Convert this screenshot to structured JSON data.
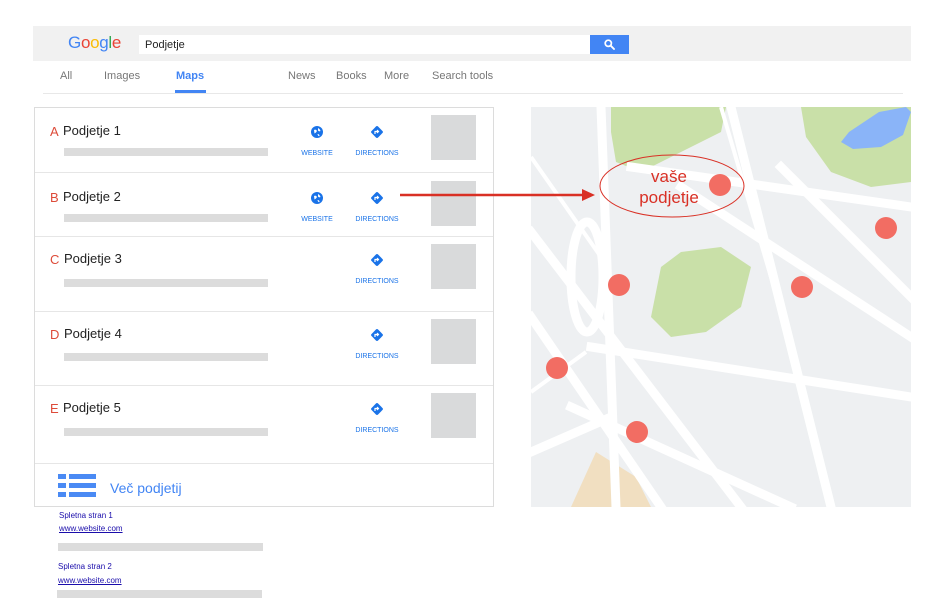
{
  "logo": {
    "letters": [
      "G",
      "o",
      "o",
      "g",
      "l",
      "e"
    ],
    "colors": [
      "#4285f4",
      "#ea4335",
      "#fbbc05",
      "#4285f4",
      "#34a853",
      "#ea4335"
    ]
  },
  "search": {
    "value": "Podjetje"
  },
  "tabs": [
    {
      "label": "All"
    },
    {
      "label": "Images"
    },
    {
      "label": "Maps"
    },
    {
      "label": "News"
    },
    {
      "label": "Books"
    },
    {
      "label": "More"
    },
    {
      "label": "Search tools"
    }
  ],
  "listings": [
    {
      "letter": "A",
      "name": "Podjetje  1",
      "website_label": "WEBSITE",
      "directions_label": "DIRECTIONS"
    },
    {
      "letter": "B",
      "name": "Podjetje  2",
      "website_label": "WEBSITE",
      "directions_label": "DIRECTIONS"
    },
    {
      "letter": "C",
      "name": "Podjetje  3",
      "directions_label": "DIRECTIONS"
    },
    {
      "letter": "D",
      "name": "Podjetje  4",
      "directions_label": "DIRECTIONS"
    },
    {
      "letter": "E",
      "name": "Podjetje  5",
      "directions_label": "DIRECTIONS"
    }
  ],
  "more_businesses": {
    "label": "Več podjetij",
    "icon": "list-icon"
  },
  "web_results": [
    {
      "title": "Spletna stran 1",
      "url": "www.website.com"
    },
    {
      "title": "Spletna stran 2",
      "url": "www.website.com"
    }
  ],
  "map": {
    "callout": {
      "line1": "vaše",
      "line2": "podjetje"
    },
    "colors": {
      "park": "#c9e0a8",
      "water": "#8ab4f8",
      "pin": "#f26d63",
      "sand": "#f1dfc1",
      "road": "#ffffff",
      "arrow": "#d93025"
    }
  }
}
